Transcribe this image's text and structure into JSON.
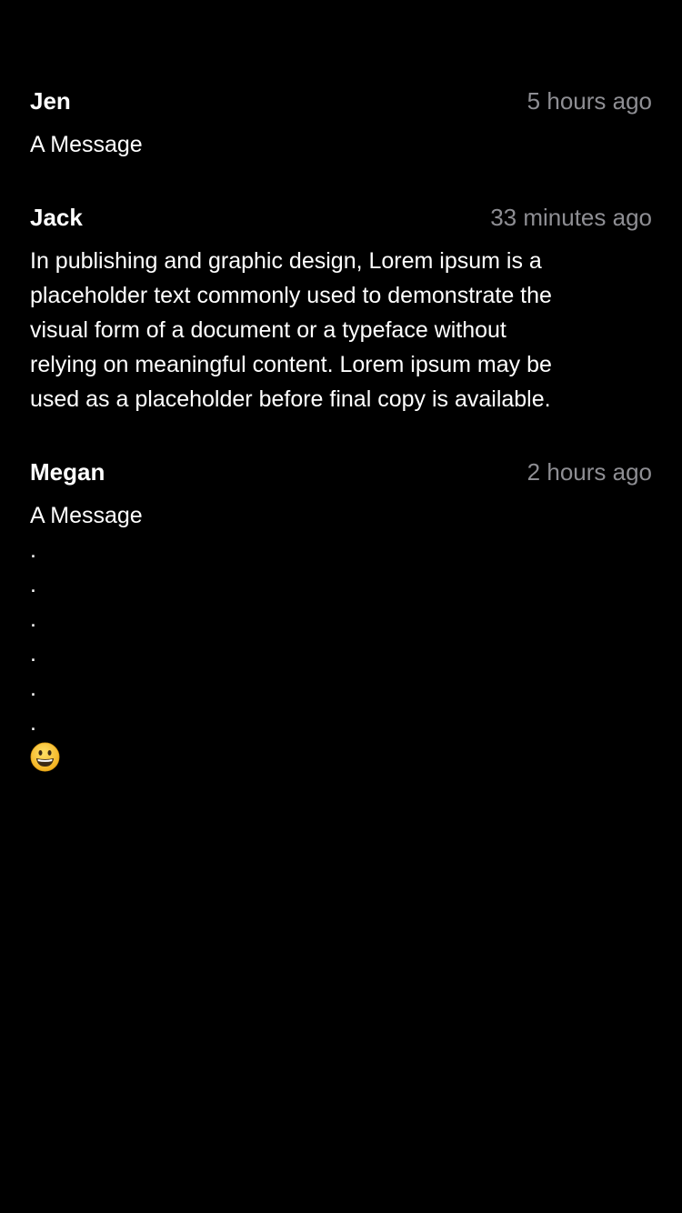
{
  "messages": [
    {
      "author": "Jen",
      "time": "5 hours ago",
      "text": "A Message"
    },
    {
      "author": "Jack",
      "time": "33 minutes ago",
      "text": "In publishing and graphic design, Lorem ipsum is a\nplaceholder text commonly used to demonstrate the\nvisual form of a document or a typeface without\nrelying on meaningful content. Lorem ipsum may be\nused as a placeholder before final copy is available."
    },
    {
      "author": "Megan",
      "time": "2 hours ago",
      "text": "A Message\n.\n.\n.\n.\n.\n.",
      "emoji": "grinning-face-icon"
    }
  ],
  "colors": {
    "background": "#000000",
    "text": "#ffffff",
    "timestamp": "#8e8e93",
    "emoji": "#f5c518"
  }
}
